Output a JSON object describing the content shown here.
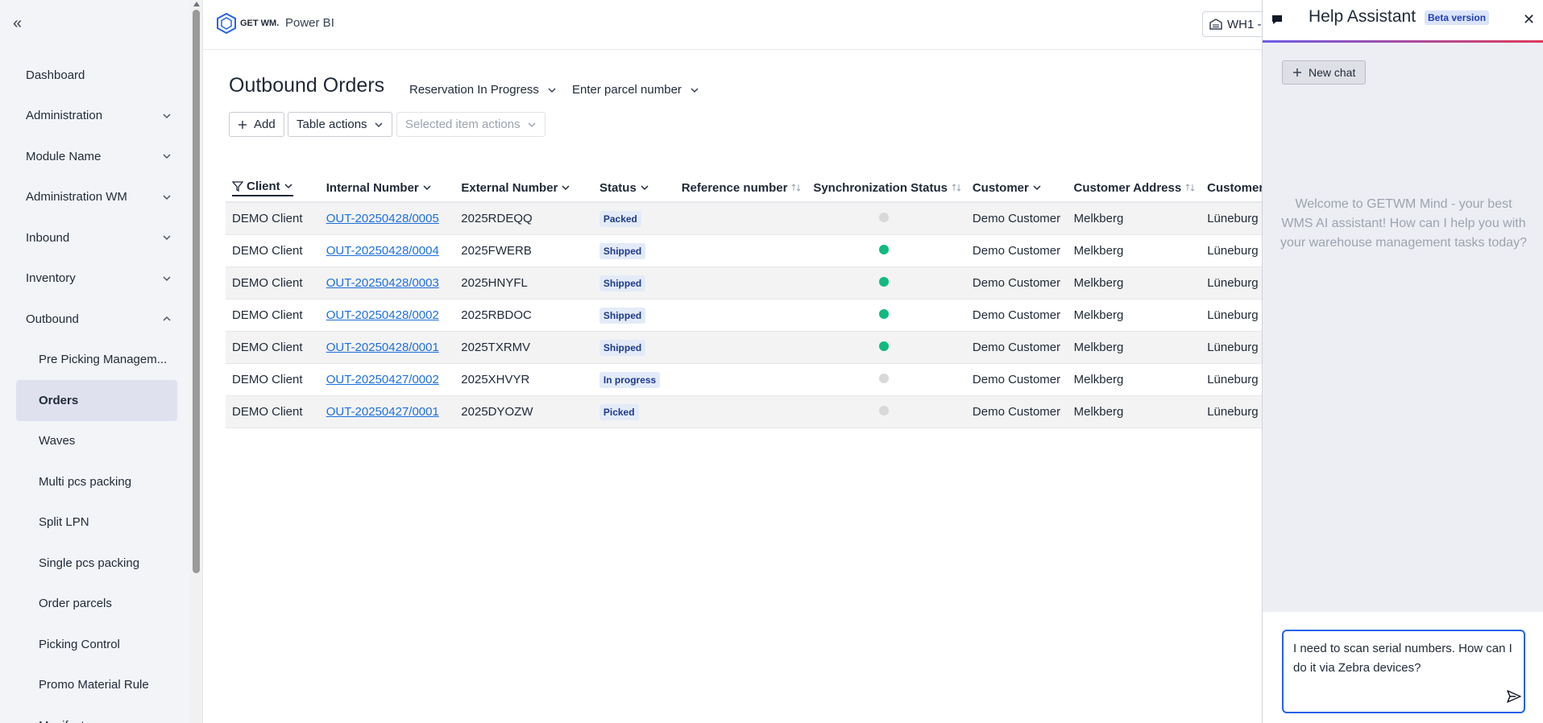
{
  "sidebar": {
    "collapse_icon": "«",
    "items": [
      {
        "label": "Dashboard",
        "chevron": ""
      },
      {
        "label": "Administration",
        "chevron": "down"
      },
      {
        "label": "Module Name",
        "chevron": "down"
      },
      {
        "label": "Administration WM",
        "chevron": "down"
      },
      {
        "label": "Inbound",
        "chevron": "down"
      },
      {
        "label": "Inventory",
        "chevron": "down"
      },
      {
        "label": "Outbound",
        "chevron": "up"
      }
    ],
    "sub_items": [
      {
        "label": "Pre Picking Managem..."
      },
      {
        "label": "Orders"
      },
      {
        "label": "Waves"
      },
      {
        "label": "Multi pcs packing"
      },
      {
        "label": "Split LPN"
      },
      {
        "label": "Single pcs packing"
      },
      {
        "label": "Order parcels"
      },
      {
        "label": "Picking Control"
      },
      {
        "label": "Promo Material Rule"
      },
      {
        "label": "Manifest"
      }
    ]
  },
  "header": {
    "logo_text": "GET WM.",
    "app_link": "Power BI",
    "warehouse": "WH1 -"
  },
  "main": {
    "title": "Outbound Orders",
    "filter_status": "Reservation In Progress",
    "filter_parcel": "Enter parcel number",
    "add_label": "Add",
    "table_actions_label": "Table actions",
    "selected_actions_label": "Selected item actions"
  },
  "table": {
    "columns": [
      "Client",
      "Internal Number",
      "External Number",
      "Status",
      "Reference number",
      "Synchronization Status",
      "Customer",
      "Customer Address",
      "Customer"
    ],
    "rows": [
      {
        "client": "DEMO Client",
        "internal": "OUT-20250428/0005",
        "external": "2025RDEQQ",
        "status": "Packed",
        "reference": "",
        "sync": "grey",
        "customer": "Demo Customer",
        "address": "Melkberg",
        "city": "Lüneburg"
      },
      {
        "client": "DEMO Client",
        "internal": "OUT-20250428/0004",
        "external": "2025FWERB",
        "status": "Shipped",
        "reference": "",
        "sync": "green",
        "customer": "Demo Customer",
        "address": "Melkberg",
        "city": "Lüneburg"
      },
      {
        "client": "DEMO Client",
        "internal": "OUT-20250428/0003",
        "external": "2025HNYFL",
        "status": "Shipped",
        "reference": "",
        "sync": "green",
        "customer": "Demo Customer",
        "address": "Melkberg",
        "city": "Lüneburg"
      },
      {
        "client": "DEMO Client",
        "internal": "OUT-20250428/0002",
        "external": "2025RBDOC",
        "status": "Shipped",
        "reference": "",
        "sync": "green",
        "customer": "Demo Customer",
        "address": "Melkberg",
        "city": "Lüneburg"
      },
      {
        "client": "DEMO Client",
        "internal": "OUT-20250428/0001",
        "external": "2025TXRMV",
        "status": "Shipped",
        "reference": "",
        "sync": "green",
        "customer": "Demo Customer",
        "address": "Melkberg",
        "city": "Lüneburg"
      },
      {
        "client": "DEMO Client",
        "internal": "OUT-20250427/0002",
        "external": "2025XHVYR",
        "status": "In progress",
        "reference": "",
        "sync": "grey",
        "customer": "Demo Customer",
        "address": "Melkberg",
        "city": "Lüneburg"
      },
      {
        "client": "DEMO Client",
        "internal": "OUT-20250427/0001",
        "external": "2025DYOZW",
        "status": "Picked",
        "reference": "",
        "sync": "grey",
        "customer": "Demo Customer",
        "address": "Melkberg",
        "city": "Lüneburg"
      }
    ]
  },
  "help": {
    "title": "Help Assistant",
    "beta": "Beta version",
    "new_chat": "New chat",
    "welcome": "Welcome to GETWM Mind - your best WMS AI assistant! How can I help you with your warehouse management tasks today?",
    "input_value": "I need to scan serial numbers. How can I do it via Zebra devices?"
  },
  "colors": {
    "sync_green": "#10b981",
    "sync_grey": "#d9d9d9",
    "link": "#1d6fdc",
    "accent_blue": "#2563eb"
  }
}
